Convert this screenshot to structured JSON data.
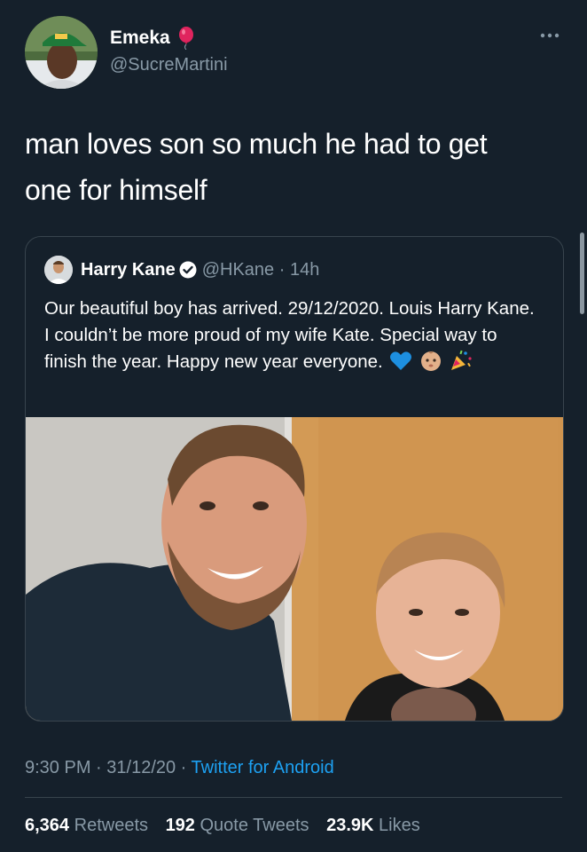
{
  "author": {
    "display_name": "Emeka",
    "handle": "@SucreMartini",
    "avatar_icon": "profile-photo-green-cap",
    "badge_icon": "balloon-icon"
  },
  "tweet": {
    "text_line1": "man loves son so much he had to get",
    "text_line2": "one for himself"
  },
  "quoted": {
    "display_name": "Harry Kane",
    "verified_icon": "verified-badge-icon",
    "handle": "@HKane",
    "separator": " · ",
    "age": "14h",
    "text": "Our beautiful boy has arrived. 29/12/2020. Louis Harry Kane. I couldn’t be more proud of my wife Kate. Special way to finish the year. Happy new year everyone.",
    "emojis": [
      "blue-heart-icon",
      "baby-icon",
      "party-popper-icon"
    ]
  },
  "meta": {
    "time": "9:30 PM",
    "separator1": " · ",
    "date": "31/12/20",
    "separator2": " · ",
    "source": "Twitter for Android"
  },
  "stats": {
    "retweets_count": "6,364",
    "retweets_label": "Retweets",
    "quotes_count": "192",
    "quotes_label": "Quote Tweets",
    "likes_count": "23.9K",
    "likes_label": "Likes"
  },
  "colors": {
    "background": "#15202b",
    "secondary_text": "#8899a6",
    "link": "#1da1f2",
    "border": "#38444d"
  }
}
